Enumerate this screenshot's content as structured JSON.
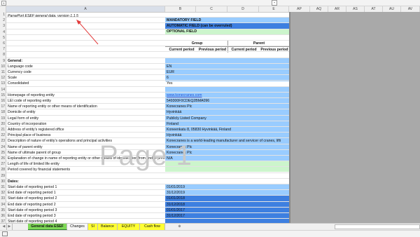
{
  "sheet": {
    "columns": [
      "A",
      "B",
      "C",
      "D",
      "E",
      "AP",
      "AQ",
      "AR",
      "AS",
      "AT",
      "AU",
      "AV"
    ],
    "selected_column": "A"
  },
  "title_cell": "ParsePort ESEF general data, version 1.1.5",
  "legend": {
    "mandatory": "MANDATORY FIELD",
    "automatic": "AUTOMATIC FIELD (can be overruled)",
    "optional": "OPTIONAL FIELD"
  },
  "headers": {
    "group": "Group",
    "parent": "Parent",
    "current_period": "Current period",
    "previous_period": "Previous period"
  },
  "rows": [
    {
      "n": "1",
      "a": "",
      "b": ""
    },
    {
      "n": "2",
      "a": "",
      "b": ""
    },
    {
      "n": "3",
      "a": "",
      "b": ""
    },
    {
      "n": "4",
      "a": "",
      "b": ""
    },
    {
      "n": "5",
      "a": "",
      "b": ""
    },
    {
      "n": "6",
      "a": "",
      "b": ""
    },
    {
      "n": "7",
      "a": "",
      "b": ""
    },
    {
      "n": "8",
      "a": "",
      "b": ""
    },
    {
      "n": "9",
      "a": "General:",
      "b": ""
    },
    {
      "n": "10",
      "a": "Language code",
      "b": "EN"
    },
    {
      "n": "11",
      "a": "Currency code",
      "b": "EUR"
    },
    {
      "n": "12",
      "a": "Scale",
      "b": "6"
    },
    {
      "n": "13",
      "a": "Consolidated",
      "b": "Yes"
    },
    {
      "n": "14",
      "a": "",
      "b": ""
    },
    {
      "n": "15",
      "a": "Homepage of reporting entity",
      "b": "www.konecranes.com"
    },
    {
      "n": "16",
      "a": "LEI code of reporting entity",
      "b": "549300F0CDEQ2BMA096"
    },
    {
      "n": "17",
      "a": "Name of reporting entity or other means of identification",
      "b": "Konecranes Plc"
    },
    {
      "n": "18",
      "a": "Domicile of entity",
      "b": "Hyvinkää"
    },
    {
      "n": "19",
      "a": "Legal form of entity",
      "b": "Publicly Listed Company"
    },
    {
      "n": "20",
      "a": "Country of incorporation",
      "b": "Finland"
    },
    {
      "n": "21",
      "a": "Address of entity's registered office",
      "b": "Koneenkatu 8, 05830 Hyvinkää, Finland"
    },
    {
      "n": "22",
      "a": "Principal place of business",
      "b": "Hyvinkää"
    },
    {
      "n": "23",
      "a": "Description of nature of entity's operations and principal activities",
      "b": "Konecranes is a world-leading manufacturer and servicer of cranes, lifti"
    },
    {
      "n": "24",
      "a": "Name of parent entity",
      "b": "Konecranes Plc"
    },
    {
      "n": "25",
      "a": "Name of ultimate parent of group",
      "b": "Konecranes Plc"
    },
    {
      "n": "26",
      "a": "Explanation of change in name of reporting entity or other means of identification from end of preceding reporting period",
      "b": "N/A"
    },
    {
      "n": "27",
      "a": "Length of life of limited life entity",
      "b": ""
    },
    {
      "n": "28",
      "a": "Period covered by financial statements",
      "b": ""
    },
    {
      "n": "29",
      "a": "",
      "b": ""
    },
    {
      "n": "30",
      "a": "Dates:",
      "b": ""
    },
    {
      "n": "31",
      "a": "Start date of reporting period 1",
      "b": "01/01/2019"
    },
    {
      "n": "32",
      "a": "End date of reporting period 1",
      "b": "31/12/2019"
    },
    {
      "n": "33",
      "a": "Start date of reporting period 2",
      "b": "01/01/2018"
    },
    {
      "n": "34",
      "a": "End date of reporting period 2",
      "b": "31/12/2018"
    },
    {
      "n": "35",
      "a": "Start date of reporting period 3",
      "b": "01/01/2017"
    },
    {
      "n": "36",
      "a": "End date of reporting period 3",
      "b": "31/12/2017"
    },
    {
      "n": "37",
      "a": "Start date of reporting period 4",
      "b": ""
    }
  ],
  "watermark": "Page 1",
  "tabs": [
    "General data ESEF",
    "Changes",
    "SI",
    "Balance",
    "EQUITY",
    "Cash flow"
  ],
  "active_tab": "General data ESEF",
  "add_sheet_icon": "plus-circle-icon",
  "colors": {
    "light_blue": "#99ccff",
    "dark_blue": "#3d7fe0",
    "light_green": "#ccf5cc",
    "tab_green": "#7ed957",
    "tab_yellow": "#ffff33",
    "gray_area": "#a9a9a9"
  }
}
